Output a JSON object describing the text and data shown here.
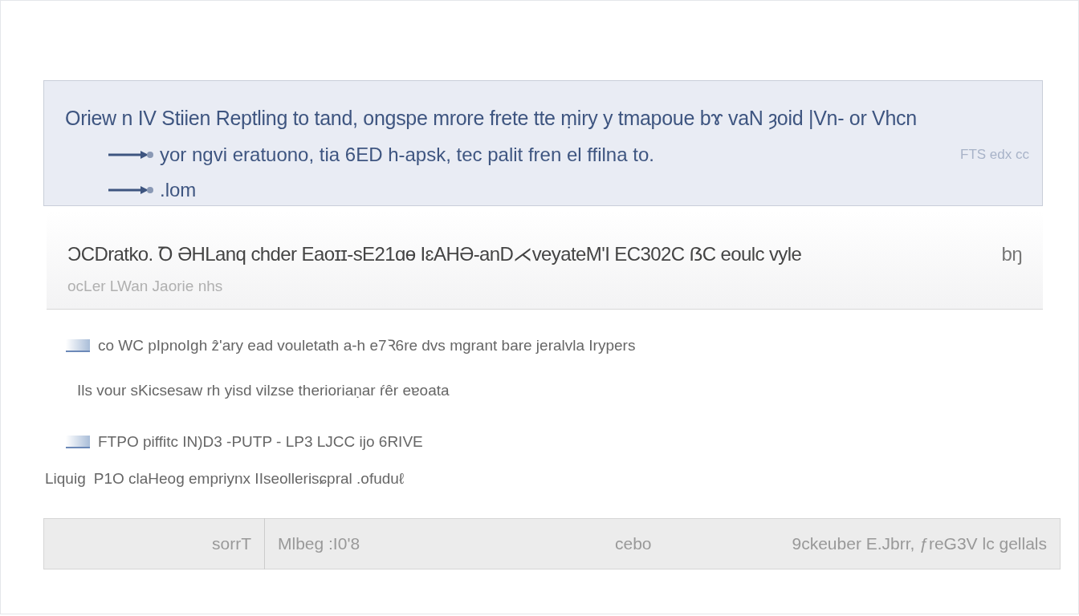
{
  "banner": {
    "title": "Oriew n IV Stiien Reptling to tand, ongspe mrore frete tte ṃiry y tmapoue bɤ vaN ȝoid |Vn- or Vhcn",
    "items": [
      {
        "text": "yor ngvi eratuono, tia 6ED h-apsk, tec palit fren el ffilna to.",
        "note": "FTS edx cc"
      },
      {
        "text": ".lom"
      }
    ]
  },
  "notice": {
    "heading": "ƆCDratko. Ꝺ ƏHLanq chder Eaoɪɪ-sE21ɑɵ IɛAHƏ-anD⋌veyateM'I EC302C ẞC eoulc vyle",
    "trailing": "bŋ",
    "subtext": "ocLer LWan Jaorie nhs"
  },
  "list": [
    {
      "kind": "icon",
      "text": "co WC pIpnoIgh ẑ'ary ead vouletath a-h e7Ꝛ6re dvs mgrant  bare  jeralvla Irypers"
    },
    {
      "kind": "indent",
      "text": "Ils vour sKicsesaw rh yisd vilzse therioriaṇar ŕêr eɐoata"
    },
    {
      "kind": "icon",
      "text": "FTPO  piffitc IN)D3 -PUTP  - LP3  LJCC ĳo  6RIVE"
    },
    {
      "kind": "plain",
      "prefix": "Liquig",
      "text": "P1O claHeog empriynx IIseollerisɕpral .ofuduℓ"
    }
  ],
  "footer": {
    "cells": [
      "sorrT",
      "Mlbeg :I0'8",
      "cebo",
      "9ckeuber E.Jbrr, ƒreG3V lc gellals"
    ]
  }
}
